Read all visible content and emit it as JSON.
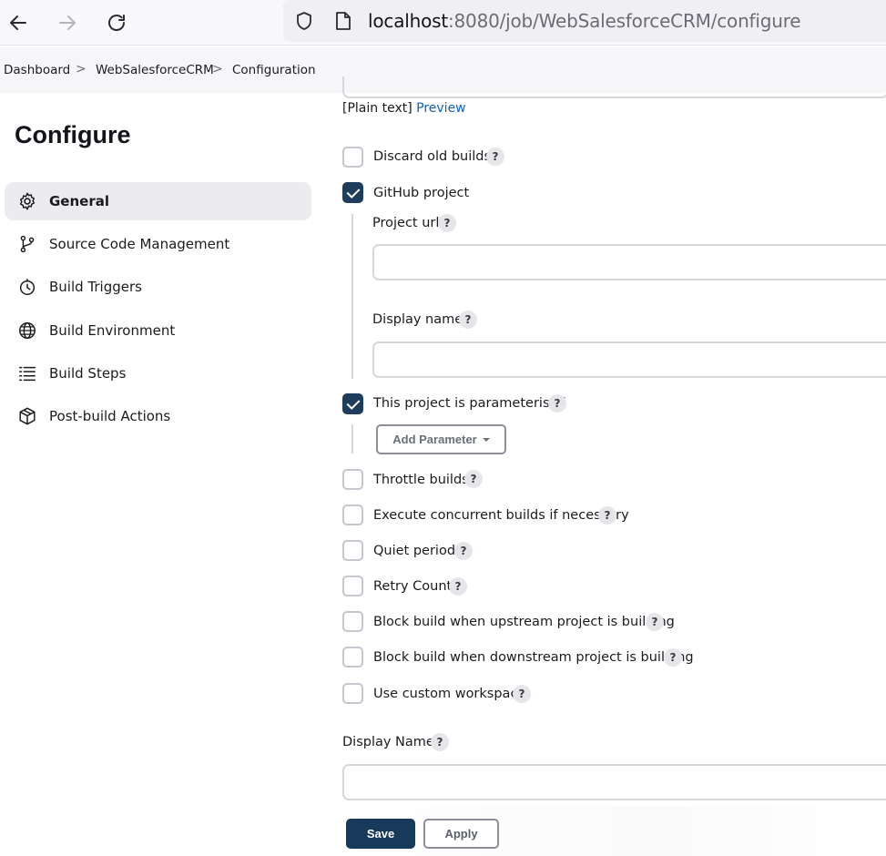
{
  "browser": {
    "url_host": "localhost",
    "url_rest": ":8080/job/WebSalesforceCRM/configure"
  },
  "breadcrumb": {
    "items": [
      "Dashboard",
      "WebSalesforceCRM",
      "Configuration"
    ],
    "separator": ">"
  },
  "sidebar": {
    "title": "Configure",
    "items": [
      {
        "label": "General",
        "icon": "gear-icon",
        "active": true
      },
      {
        "label": "Source Code Management",
        "icon": "branch-icon",
        "active": false
      },
      {
        "label": "Build Triggers",
        "icon": "timer-icon",
        "active": false
      },
      {
        "label": "Build Environment",
        "icon": "globe-icon",
        "active": false
      },
      {
        "label": "Build Steps",
        "icon": "list-icon",
        "active": false
      },
      {
        "label": "Post-build Actions",
        "icon": "package-icon",
        "active": false
      }
    ]
  },
  "main": {
    "plain_text": "[Plain text]",
    "preview_label": "Preview",
    "options": {
      "discard_old_builds": {
        "label": "Discard old builds",
        "checked": false
      },
      "github_project": {
        "label": "GitHub project",
        "checked": true
      },
      "parameterised": {
        "label": "This project is parameterised",
        "checked": true
      },
      "throttle": {
        "label": "Throttle builds",
        "checked": false
      },
      "concurrent": {
        "label": "Execute concurrent builds if necessary",
        "checked": false
      },
      "quiet_period": {
        "label": "Quiet period",
        "checked": false
      },
      "retry_count": {
        "label": "Retry Count",
        "checked": false
      },
      "block_upstream": {
        "label": "Block build when upstream project is building",
        "checked": false
      },
      "block_downstream": {
        "label": "Block build when downstream project is building",
        "checked": false
      },
      "custom_workspace": {
        "label": "Use custom workspace",
        "checked": false
      }
    },
    "github": {
      "project_url_label": "Project url",
      "project_url_value": "",
      "display_name_label": "Display name",
      "display_name_value": ""
    },
    "add_parameter_label": "Add Parameter",
    "display_name_label": "Display Name",
    "display_name_value": "",
    "help_glyph": "?"
  },
  "footer": {
    "save_label": "Save",
    "apply_label": "Apply"
  }
}
